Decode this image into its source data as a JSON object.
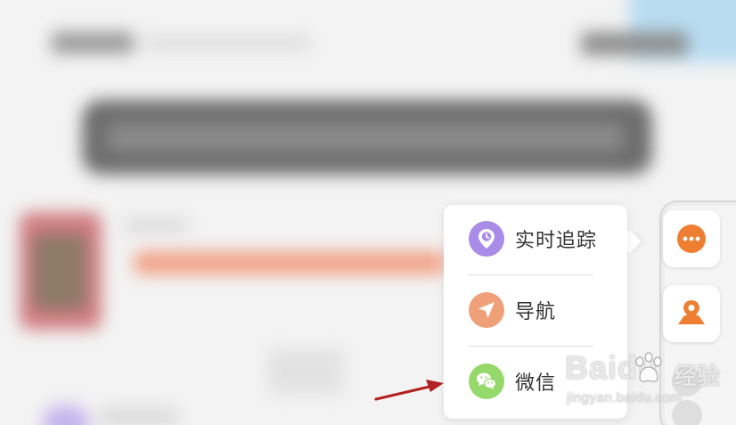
{
  "menu": {
    "items": [
      {
        "label": "实时追踪",
        "icon": "realtime-location-icon",
        "color": "#a98be8"
      },
      {
        "label": "导航",
        "icon": "navigation-arrow-icon",
        "color": "#f0a079"
      },
      {
        "label": "微信",
        "icon": "wechat-icon",
        "color": "#94d96a"
      }
    ]
  },
  "side_buttons": {
    "more_icon": "more-dots-icon",
    "map_icon": "map-location-icon",
    "accent": "#ee7f32"
  },
  "annotation": {
    "arrow_color": "#b32222"
  },
  "watermark": {
    "brand": "Baidu",
    "product": "经验",
    "url": "jingyan.baidu.com"
  }
}
